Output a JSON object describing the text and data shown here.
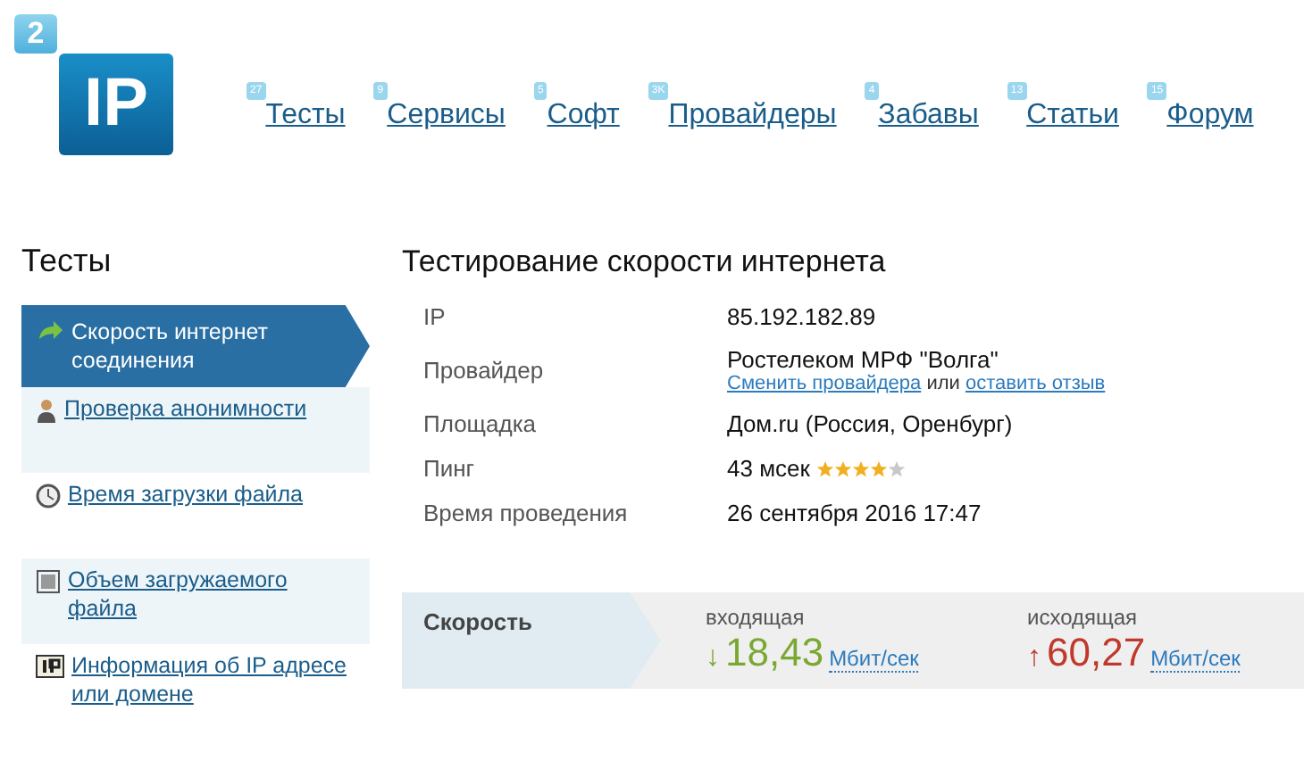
{
  "logo": {
    "badge": "2",
    "text": "IP"
  },
  "nav": [
    {
      "label": "Тесты",
      "count": "27"
    },
    {
      "label": "Сервисы",
      "count": "9"
    },
    {
      "label": "Софт",
      "count": "5"
    },
    {
      "label": "Провайдеры",
      "count": "3K"
    },
    {
      "label": "Забавы",
      "count": "4"
    },
    {
      "label": "Статьи",
      "count": "13"
    },
    {
      "label": "Форум",
      "count": "15"
    }
  ],
  "sidebar": {
    "title": "Тесты",
    "items": [
      {
        "label": "Скорость интернет соединения",
        "selected": true
      },
      {
        "label": "Проверка анонимности",
        "selected": false
      },
      {
        "label": "Время загрузки файла",
        "selected": false
      },
      {
        "label": "Объем загружаемого файла",
        "selected": false
      },
      {
        "label": "Информация об IP адресе или домене",
        "selected": false
      }
    ]
  },
  "main": {
    "title": "Тестирование скорости интернета",
    "rows": [
      {
        "kind": "plain",
        "label": "IP",
        "value": "85.192.182.89"
      },
      {
        "kind": "provider",
        "label": "Провайдер",
        "value": "Ростелеком МРФ \"Волга\"",
        "link1": "Сменить провайдера",
        "or": "или",
        "link2": "оставить отзыв"
      },
      {
        "kind": "plain",
        "label": "Площадка",
        "value": "Дом.ru (Россия, Оренбург)"
      },
      {
        "kind": "rating",
        "label": "Пинг",
        "value": "43 мсек",
        "stars": 4
      },
      {
        "kind": "plain",
        "label": "Время проведения",
        "value": "26 сентября 2016 17:47"
      }
    ],
    "speed": {
      "label": "Скорость",
      "items": [
        {
          "kind": "down",
          "caption": "входящая",
          "arrow": "↓",
          "value": "18,43",
          "unit": "Мбит/сек"
        },
        {
          "kind": "up",
          "caption": "исходящая",
          "arrow": "↑",
          "value": "60,27",
          "unit": "Мбит/сек"
        }
      ]
    }
  }
}
